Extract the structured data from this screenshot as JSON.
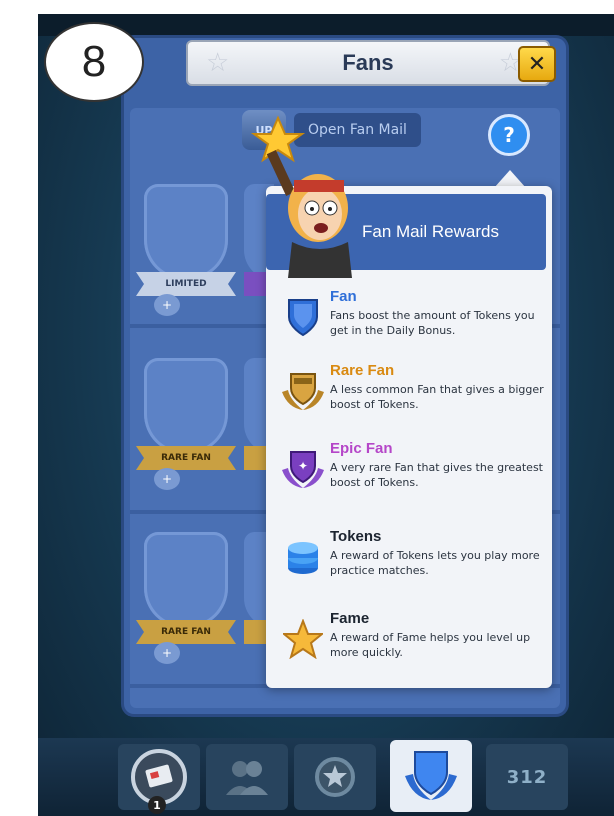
{
  "step_badge": "8",
  "header": {
    "title": "Fans"
  },
  "close_label": "✕",
  "open_fan_mail": {
    "label": "Open Fan Mail",
    "icon_text": "UP"
  },
  "help_label": "?",
  "slots": {
    "row1_label": "LIMITED",
    "row2_label": "RARE FAN",
    "row3_label": "RARE FAN"
  },
  "popup": {
    "title": "Fan Mail Rewards",
    "rewards": [
      {
        "name": "Fan",
        "desc": "Fans boost the amount of Tokens you get in the Daily Bonus.",
        "color": "#2f6fd8",
        "icon": "blue-shield-icon"
      },
      {
        "name": "Rare Fan",
        "desc": "A less common Fan that gives a bigger boost of Tokens.",
        "color": "#d98a12",
        "icon": "gold-shield-icon"
      },
      {
        "name": "Epic Fan",
        "desc": "A very rare Fan that gives the greatest boost of Tokens.",
        "color": "#b546c8",
        "icon": "purple-shield-icon"
      },
      {
        "name": "Tokens",
        "desc": "A reward of Tokens lets you play more practice matches.",
        "color": "#1c2430",
        "icon": "tokens-icon"
      },
      {
        "name": "Fame",
        "desc": "A reward of Fame helps you level up more quickly.",
        "color": "#1c2430",
        "icon": "star-icon"
      }
    ]
  },
  "bottom_tabs": {
    "badge_count": "1",
    "leaderboard_digits": "312"
  }
}
